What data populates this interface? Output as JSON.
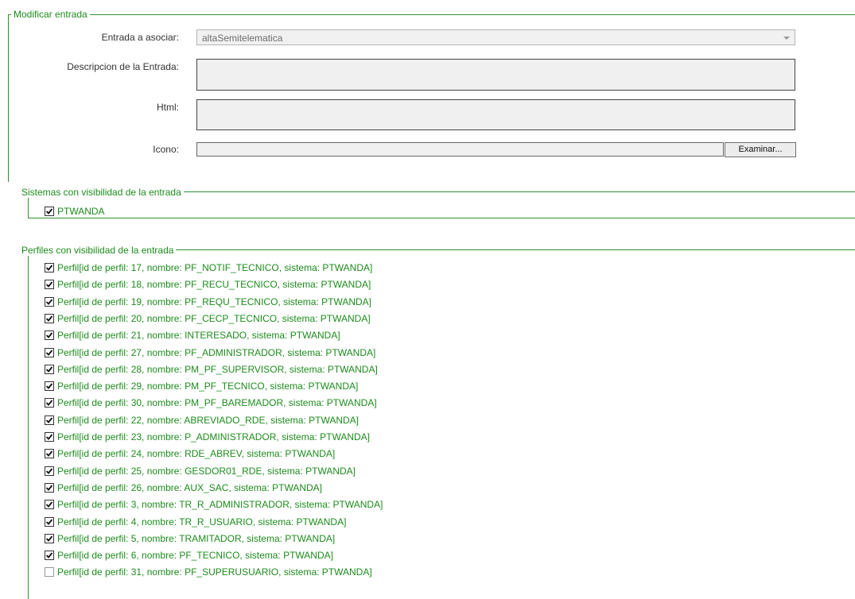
{
  "modify_section": {
    "legend": "Modificar entrada",
    "entrada_label": "Entrada a asociar:",
    "entrada_value": "altaSemitelematica",
    "descripcion_label": "Descripcion de la Entrada:",
    "descripcion_value": "",
    "html_label": "Html:",
    "html_value": "",
    "icono_label": "Icono:",
    "icono_value": "",
    "browse_label": "Examinar..."
  },
  "systems_section": {
    "legend": "Sistemas con visibilidad de la entrada",
    "items": [
      {
        "label": "PTWANDA",
        "checked": true
      }
    ]
  },
  "profiles_section": {
    "legend": "Perfiles con visibilidad de la entrada",
    "items": [
      {
        "label": "Perfil[id de perfil: 17, nombre: PF_NOTIF_TECNICO, sistema: PTWANDA]",
        "checked": true
      },
      {
        "label": "Perfil[id de perfil: 18, nombre: PF_RECU_TECNICO, sistema: PTWANDA]",
        "checked": true
      },
      {
        "label": "Perfil[id de perfil: 19, nombre: PF_REQU_TECNICO, sistema: PTWANDA]",
        "checked": true
      },
      {
        "label": "Perfil[id de perfil: 20, nombre: PF_CECP_TECNICO, sistema: PTWANDA]",
        "checked": true
      },
      {
        "label": "Perfil[id de perfil: 21, nombre: INTERESADO, sistema: PTWANDA]",
        "checked": true
      },
      {
        "label": "Perfil[id de perfil: 27, nombre: PF_ADMINISTRADOR, sistema: PTWANDA]",
        "checked": true
      },
      {
        "label": "Perfil[id de perfil: 28, nombre: PM_PF_SUPERVISOR, sistema: PTWANDA]",
        "checked": true
      },
      {
        "label": "Perfil[id de perfil: 29, nombre: PM_PF_TECNICO, sistema: PTWANDA]",
        "checked": true
      },
      {
        "label": "Perfil[id de perfil: 30, nombre: PM_PF_BAREMADOR, sistema: PTWANDA]",
        "checked": true
      },
      {
        "label": "Perfil[id de perfil: 22, nombre: ABREVIADO_RDE, sistema: PTWANDA]",
        "checked": true
      },
      {
        "label": "Perfil[id de perfil: 23, nombre: P_ADMINISTRADOR, sistema: PTWANDA]",
        "checked": true
      },
      {
        "label": "Perfil[id de perfil: 24, nombre: RDE_ABREV, sistema: PTWANDA]",
        "checked": true
      },
      {
        "label": "Perfil[id de perfil: 25, nombre: GESDOR01_RDE, sistema: PTWANDA]",
        "checked": true
      },
      {
        "label": "Perfil[id de perfil: 26, nombre: AUX_SAC, sistema: PTWANDA]",
        "checked": true
      },
      {
        "label": "Perfil[id de perfil: 3, nombre: TR_R_ADMINISTRADOR, sistema: PTWANDA]",
        "checked": true
      },
      {
        "label": "Perfil[id de perfil: 4, nombre: TR_R_USUARIO, sistema: PTWANDA]",
        "checked": true
      },
      {
        "label": "Perfil[id de perfil: 5, nombre: TRAMITADOR, sistema: PTWANDA]",
        "checked": true
      },
      {
        "label": "Perfil[id de perfil: 6, nombre: PF_TECNICO, sistema: PTWANDA]",
        "checked": true
      },
      {
        "label": "Perfil[id de perfil: 31, nombre: PF_SUPERUSUARIO, sistema: PTWANDA]",
        "checked": false
      }
    ]
  }
}
